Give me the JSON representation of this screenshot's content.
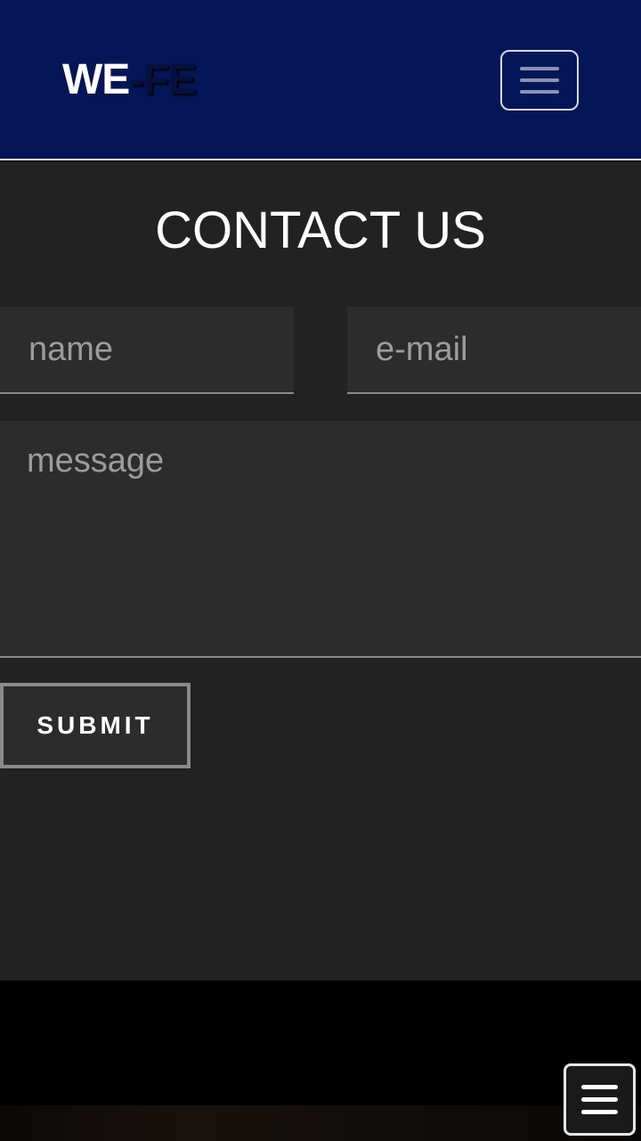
{
  "navbar": {
    "brand": {
      "part1": "WE",
      "dash": "-",
      "part2": "FE"
    },
    "toggle_icon": "hamburger-menu-icon"
  },
  "contact": {
    "title": "CONTACT US",
    "name_placeholder": "name",
    "email_placeholder": "e-mail",
    "message_placeholder": "message",
    "submit_label": "SUBMIT"
  },
  "floating_menu": {
    "icon": "hamburger-menu-icon"
  },
  "colors": {
    "navbar_background": "#041658",
    "section_background": "#222222",
    "field_background": "#2c2c2c",
    "placeholder_text": "#9c9c9c",
    "field_border": "#8a8a8a",
    "footer_background": "#000000"
  }
}
